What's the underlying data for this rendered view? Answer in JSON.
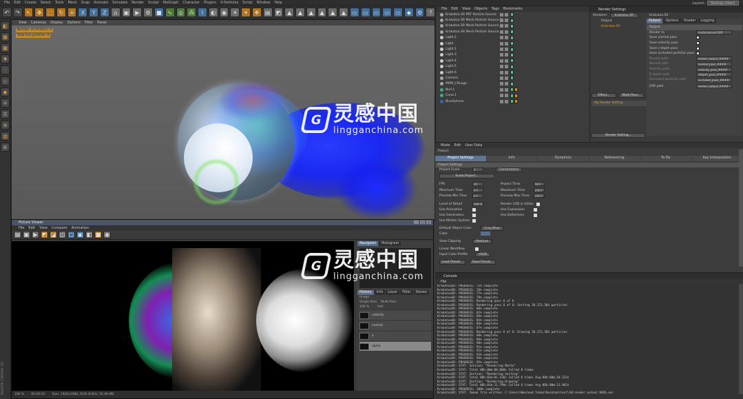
{
  "menubar": {
    "items": [
      "File",
      "Edit",
      "Create",
      "Select",
      "Tools",
      "Mesh",
      "Snap",
      "Animate",
      "Simulate",
      "Render",
      "Sculpt",
      "MoGraph",
      "Character",
      "Plugins",
      "X-Particles",
      "Script",
      "Window",
      "Help"
    ],
    "layout_label": "Layout:",
    "layout_value": "Startup (User)"
  },
  "viewport": {
    "menu": [
      "View",
      "Cameras",
      "Display",
      "Options",
      "Filter",
      "Panel"
    ],
    "hud_emitters": "Number of emitters: 0",
    "hud_particles": "Total live particles: 0"
  },
  "picture_viewer": {
    "title": "Picture Viewer",
    "menu": [
      "File",
      "Edit",
      "View",
      "Compare",
      "Animation"
    ],
    "side_tabs": [
      "Navigator",
      "Histogram"
    ],
    "sub_tabs": [
      "History",
      "Info",
      "Layer",
      "Filter",
      "Stereo"
    ],
    "layer_group": "Image",
    "mode_single": "Single-Pass",
    "mode_multi": "Multi-Pass",
    "zoom": "100 %",
    "add_label": "Add",
    "layers": [
      "velocity",
      "normal",
      "z",
      "alpha"
    ],
    "status": [
      "100 %",
      "00:00:01",
      "Size: 1920x1080, RGB (8 Bit), 56.48 MB"
    ]
  },
  "objects": {
    "menu": [
      "File",
      "Edit",
      "View",
      "Objects",
      "Tags",
      "Bookmarks"
    ],
    "rows": [
      {
        "name": "Krakatoa SR PRT Particle Source",
        "color": "#9aa"
      },
      {
        "name": "Krakatoa SR Mesh Particle Source.2",
        "color": "#9aa"
      },
      {
        "name": "Krakatoa SR Mesh Particle Source.1",
        "color": "#9aa"
      },
      {
        "name": "Krakatoa SR Mesh Particle Source",
        "color": "#9aa"
      },
      {
        "name": "Light.2",
        "color": "#ccc"
      },
      {
        "name": "Light",
        "color": "#ccc"
      },
      {
        "name": "Light.1",
        "color": "#ccc"
      },
      {
        "name": "Light.3",
        "color": "#ccc"
      },
      {
        "name": "Light.4",
        "color": "#ccc"
      },
      {
        "name": "Light.5",
        "color": "#ccc"
      },
      {
        "name": "Light.6",
        "color": "#ccc"
      },
      {
        "name": "Camera",
        "color": "#aaa"
      },
      {
        "name": "MRM_CRLogo",
        "color": "#aaa"
      },
      {
        "name": "Null.1",
        "color": "#4a8"
      },
      {
        "name": "Cone.1",
        "color": "#4a8"
      },
      {
        "name": "BlueSphere",
        "color": "#36c"
      }
    ]
  },
  "render_settings": {
    "title": "Render Settings",
    "renderer_label": "Renderer",
    "renderer_value": "Krakatoa SR",
    "header_label": "Krakatoa SR",
    "tree": [
      "Output",
      "Krakatoa SR"
    ],
    "tabs": [
      "Output",
      "Options",
      "Shader",
      "Logging"
    ],
    "section": "Output",
    "rows": [
      {
        "label": "Render to",
        "value": "multichannel EXR"
      },
      {
        "label": "Save normal pass",
        "value": ""
      },
      {
        "label": "Save velocity pass",
        "value": ""
      },
      {
        "label": "Save z depth pass",
        "value": ""
      },
      {
        "label": "Save occluded particles pass",
        "value": ""
      },
      {
        "label": "Beauty path",
        "value": "render_output_####"
      },
      {
        "label": "Normal path",
        "value": "normal_pass_####"
      },
      {
        "label": "Velocity path",
        "value": "velocity_pass_####"
      },
      {
        "label": "Z depth path",
        "value": "zdepth_pass_####"
      },
      {
        "label": "Occluded particles path",
        "value": "occluded_pass_####"
      }
    ],
    "exr_label": "EXR path",
    "exr_value": "render_output_####",
    "effect_button": "Effect...",
    "multipass_button": "Multi-Pass...",
    "my_setting": "My Render Setting",
    "render_setting_button": "Render Setting..."
  },
  "attributes": {
    "menu": [
      "Mode",
      "Edit",
      "User Data"
    ],
    "title": "Project",
    "tabs": [
      "Project Settings",
      "Info",
      "Dynamics",
      "Referencing",
      "To Do",
      "Key Interpolation"
    ],
    "section": "Project Settings",
    "project_scale_label": "Project Scale",
    "project_scale_value": "1",
    "project_scale_unit": "Centimeters",
    "scale_button": "Scale Project...",
    "fields_left": [
      {
        "label": "FPS",
        "value": "25"
      },
      {
        "label": "Minimum Time",
        "value": "0 F"
      },
      {
        "label": "Preview Min Time",
        "value": "0 F"
      },
      {
        "label": "Level of Detail",
        "value": "100 %"
      }
    ],
    "fields_right": [
      {
        "label": "Project Time",
        "value": "56 F"
      },
      {
        "label": "Maximum Time",
        "value": "250 F"
      },
      {
        "label": "Preview Max Time",
        "value": "250 F"
      },
      {
        "label": "Render LOD in Editor",
        "value": ""
      }
    ],
    "checks_left": [
      "Use Animation",
      "Use Generators",
      "Use Motion System"
    ],
    "checks_right": [
      "Use Expression",
      "Use Deformers"
    ],
    "default_color_label": "Default Object Color",
    "default_color_value": "Gray-Blue",
    "color_label": "Color",
    "view_clipping_label": "View Clipping",
    "view_clipping_value": "Medium",
    "linear_label": "Linear Workflow",
    "input_profile_label": "Input Color Profile",
    "input_profile_value": "sRGB",
    "load_button": "Load Preset...",
    "save_button": "Save Preset..."
  },
  "console": {
    "title": "Console",
    "menu": [
      "File"
    ],
    "lines": [
      "KrakatoaSR: PROGRESS: 75% complete",
      "KrakatoaSR: PROGRESS: 76% complete",
      "KrakatoaSR: PROGRESS: 77% complete",
      "KrakatoaSR: PROGRESS: 78% complete",
      "KrakatoaSR: PROGRESS: Rendering pass 6 of 6",
      "KrakatoaSR: PROGRESS: Rendering pass 6 of 6: Sorting 36,171,384 particles",
      "KrakatoaSR: PROGRESS: 80% complete",
      "KrakatoaSR: PROGRESS: 82% complete",
      "KrakatoaSR: PROGRESS: 84% complete",
      "KrakatoaSR: PROGRESS: 85% complete",
      "KrakatoaSR: PROGRESS: 86% complete",
      "KrakatoaSR: PROGRESS: 87% complete",
      "KrakatoaSR: PROGRESS: Rendering pass 6 of 6: Drawing 36,171,384 particles",
      "KrakatoaSR: PROGRESS: 88% complete",
      "KrakatoaSR: PROGRESS: 89% complete",
      "KrakatoaSR: PROGRESS: 90% complete",
      "KrakatoaSR: PROGRESS: 91% complete",
      "KrakatoaSR: PROGRESS: 92% complete",
      "KrakatoaSR: PROGRESS: 93% complete",
      "KrakatoaSR: PROGRESS: 94% complete",
      "KrakatoaSR: PROGRESS: 95% complete",
      "KrakatoaSR: STAT: Section: \"Rendering Matte\"",
      "KrakatoaSR: STAT: Total 00h:00m:00.000s Called 0 times",
      "KrakatoaSR: STAT: Section: \"Rendering Sorting\"",
      "KrakatoaSR: STAT: Total 00h:01m:01.336s Called 6 times Avg 00h:00m:10.223s",
      "KrakatoaSR: STAT: Section: \"Rendering Drawing\"",
      "KrakatoaSR: STAT: Total 00h:01m:11.790s Called 6 times Avg 00h:00m:11.965s",
      "KrakatoaSR: PROGRESS: 100% complete",
      "KrakatoaSR: STAT: Image file written: C:\\Users\\Wayland Yuhan\\Desktop\\test\\3d\\render_output_0056.exr"
    ]
  },
  "watermark": {
    "logo_glyph": "G",
    "cn": "灵感中国",
    "url": "lingganchina.com"
  },
  "colors": {
    "accent_orange": "#c08a2c",
    "tab_blue": "#5e7694",
    "particle_blue": "#1030ff"
  }
}
